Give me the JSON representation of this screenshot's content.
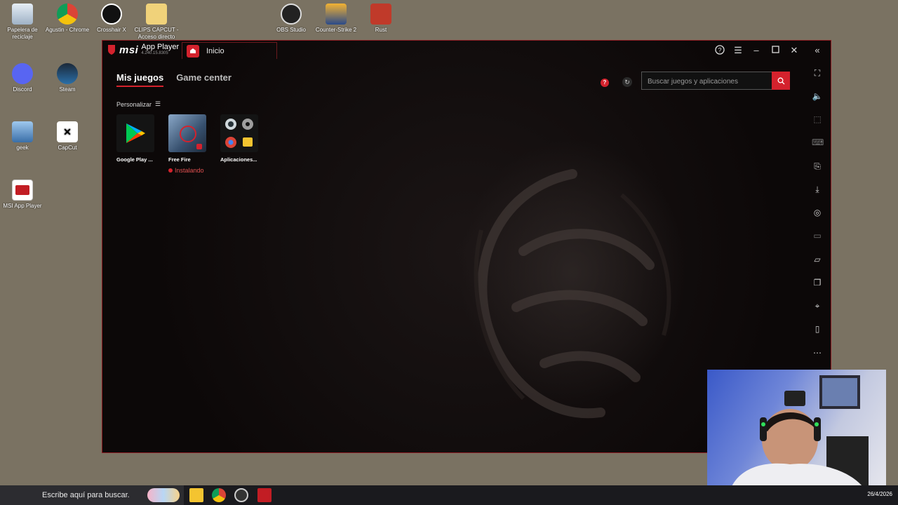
{
  "desktop": {
    "icons": [
      {
        "label": "Papelera de reciclaje",
        "icon": "recycle-bin-icon"
      },
      {
        "label": "Agustin - Chrome",
        "icon": "chrome-icon"
      },
      {
        "label": "Crosshair X",
        "icon": "crosshair-icon"
      },
      {
        "label": "CLIPS CAPCUT - Acceso directo",
        "icon": "folder-shortcut-icon"
      },
      {
        "label": "OBS Studio",
        "icon": "obs-icon"
      },
      {
        "label": "Counter-Strike 2",
        "icon": "cs2-icon"
      },
      {
        "label": "Rust",
        "icon": "rust-icon"
      },
      {
        "label": "Discord",
        "icon": "discord-icon"
      },
      {
        "label": "Steam",
        "icon": "steam-icon"
      },
      {
        "label": "geek",
        "icon": "geek-icon"
      },
      {
        "label": "CapCut",
        "icon": "capcut-icon"
      },
      {
        "label": "MSI App Player",
        "icon": "msi-app-player-icon"
      }
    ]
  },
  "window": {
    "brand": "msi",
    "app_name": "App Player",
    "version": "4.240.15.8305",
    "tab_label": "Inicio",
    "controls": [
      "help-icon",
      "menu-icon",
      "minimize-icon",
      "maximize-icon",
      "close-icon",
      "collapse-sidebar-icon"
    ]
  },
  "nav": {
    "tab_mis_juegos": "Mis juegos",
    "tab_game_center": "Game center"
  },
  "search": {
    "placeholder": "Buscar juegos y aplicaciones"
  },
  "personalizar": "Personalizar",
  "apps": [
    {
      "name": "Google Play ...",
      "status": ""
    },
    {
      "name": "Free Fire",
      "status": "Instalando"
    },
    {
      "name": "Aplicaciones...",
      "status": ""
    }
  ],
  "sidebar_icons": [
    "fullscreen-icon",
    "volume-icon",
    "pointer-icon",
    "keyboard-icon",
    "install-apk-icon",
    "download-icon",
    "screenshot-icon",
    "record-icon",
    "folder-icon",
    "multi-instance-icon",
    "location-icon",
    "shake-icon",
    "more-icon"
  ],
  "taskbar": {
    "search_placeholder": "Escribe aquí para buscar.",
    "date": "26/4/2026"
  },
  "colors": {
    "accent": "#d4222d",
    "window_bg": "#0d0909",
    "desktop_bg": "#7a7262"
  }
}
